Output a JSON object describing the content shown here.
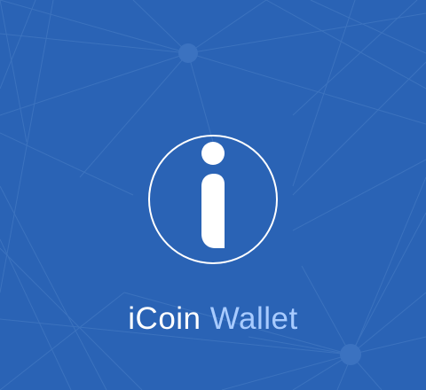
{
  "splash": {
    "app_name_part_1": "iCoin",
    "app_name_part_2": "Wallet",
    "logo_icon": "info-i-icon"
  },
  "colors": {
    "background": "#2a63b5",
    "network_line": "#3d74c0",
    "network_node": "#3a71bf",
    "logo_stroke": "#ffffff",
    "wallet_text": "#a8cbff"
  }
}
